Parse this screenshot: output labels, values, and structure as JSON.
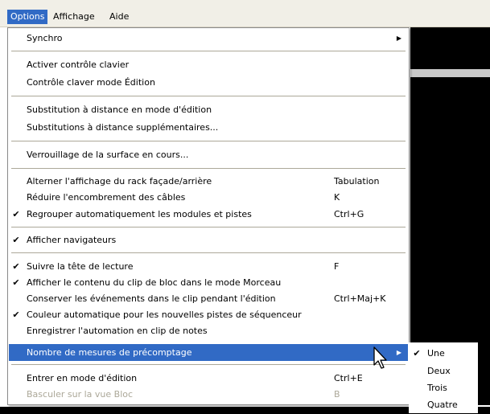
{
  "menubar": {
    "items": [
      {
        "label": "Options"
      },
      {
        "label": "Affichage"
      },
      {
        "label": "Aide"
      }
    ]
  },
  "menu": {
    "items": [
      {
        "label": "Synchro",
        "has_submenu": true
      },
      {
        "label": "Activer contrôle clavier"
      },
      {
        "label": "Contrôle claver mode Édition"
      },
      {
        "label": "Substitution à distance en mode d'édition"
      },
      {
        "label": "Substitutions à distance supplémentaires..."
      },
      {
        "label": "Verrouillage de la surface en cours..."
      },
      {
        "label": "Alterner l'affichage du rack façade/arrière",
        "shortcut": "Tabulation"
      },
      {
        "label": "Réduire l'encombrement des câbles",
        "shortcut": "K"
      },
      {
        "label": "Regrouper automatiquement les modules et pistes",
        "shortcut": "Ctrl+G",
        "checked": true
      },
      {
        "label": "Afficher navigateurs",
        "checked": true
      },
      {
        "label": "Suivre la tête de lecture",
        "shortcut": "F",
        "checked": true
      },
      {
        "label": "Afficher le contenu du clip de bloc dans le mode Morceau",
        "checked": true
      },
      {
        "label": "Conserver les événements dans le clip pendant l'édition",
        "shortcut": "Ctrl+Maj+K"
      },
      {
        "label": "Couleur automatique pour les nouvelles pistes de séquenceur",
        "checked": true
      },
      {
        "label": "Enregistrer l'automation en clip de notes"
      },
      {
        "label": "Nombre de mesures de précomptage",
        "has_submenu": true,
        "highlighted": true
      },
      {
        "label": "Entrer en mode d'édition",
        "shortcut": "Ctrl+E"
      },
      {
        "label": "Basculer sur la vue Bloc",
        "shortcut": "B",
        "disabled": true
      }
    ]
  },
  "submenu": {
    "items": [
      {
        "label": "Une",
        "checked": true
      },
      {
        "label": "Deux"
      },
      {
        "label": "Trois"
      },
      {
        "label": "Quatre"
      }
    ]
  },
  "glyphs": {
    "check": "✔",
    "submenu_arrow": "▶"
  },
  "colors": {
    "highlight": "#316ac5",
    "disabled_text": "#aca899"
  }
}
